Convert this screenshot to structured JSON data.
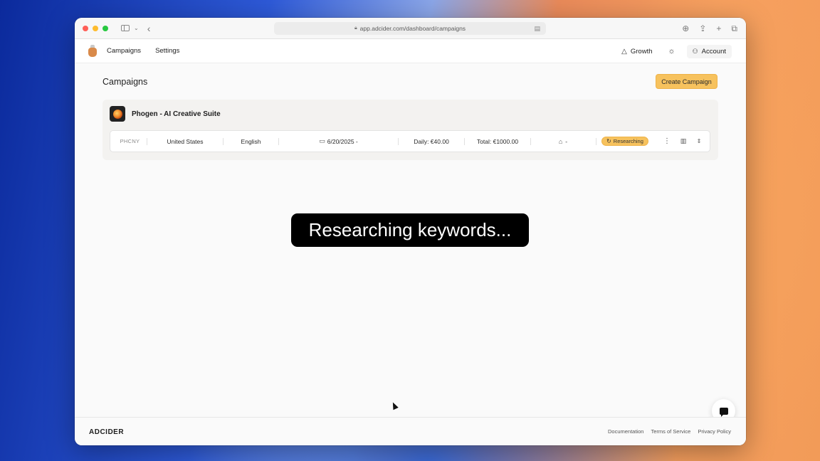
{
  "browser": {
    "url": "app.adcider.com/dashboard/campaigns"
  },
  "nav": {
    "campaigns": "Campaigns",
    "settings": "Settings",
    "growth": "Growth",
    "account": "Account"
  },
  "page": {
    "title": "Campaigns",
    "create_button": "Create Campaign"
  },
  "campaign": {
    "name": "Phogen - AI Creative Suite",
    "code": "PHCNY",
    "country": "United States",
    "language": "English",
    "date": "6/20/2025 -",
    "daily": "Daily: €40.00",
    "total": "Total: €1000.00",
    "bot_value": "-",
    "status": "Researching"
  },
  "overlay": {
    "caption": "Researching keywords..."
  },
  "footer": {
    "logo": "ADCIDER",
    "links": [
      "Documentation",
      "Terms of Service",
      "Privacy Policy"
    ]
  },
  "colors": {
    "accent": "#f7c25d"
  }
}
